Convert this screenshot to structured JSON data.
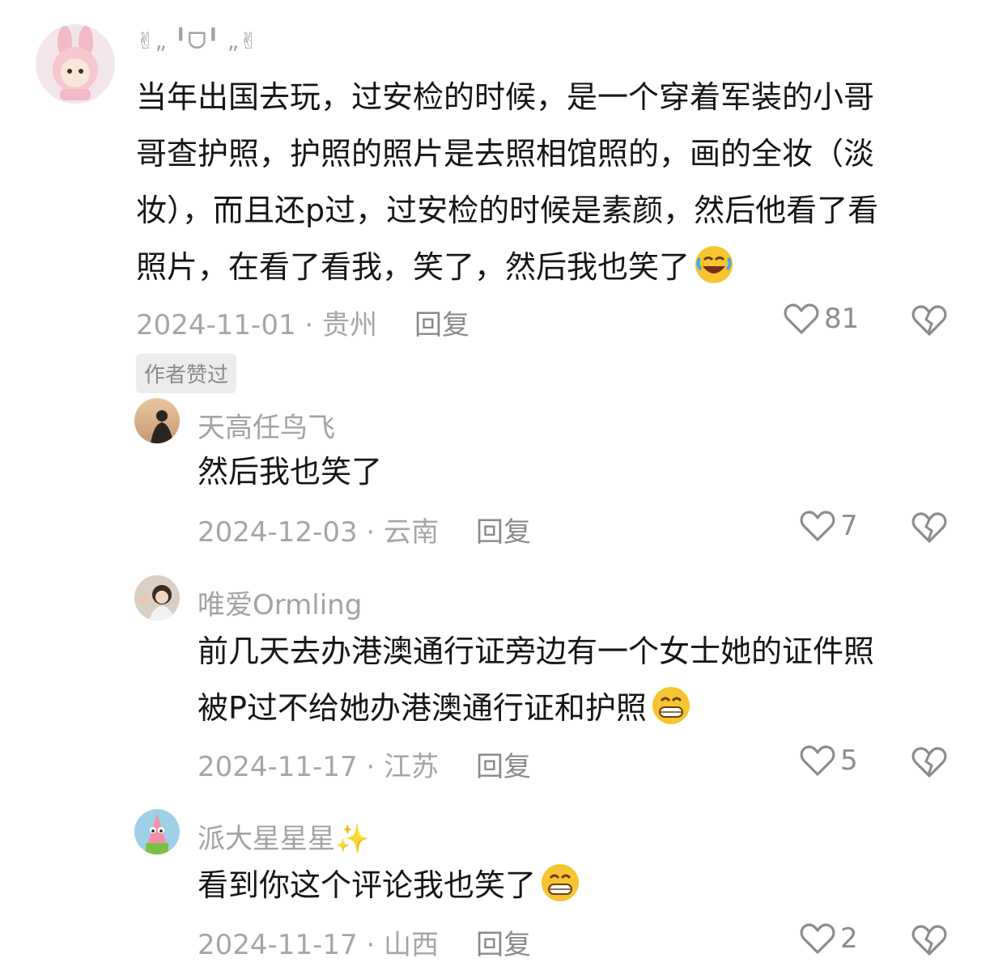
{
  "comments": [
    {
      "user": "✌︎„ ╹ᗜ╹ „✌︎",
      "lines": [
        "当年出国去玩，过安检的时候，是一个穿着军装的小哥",
        "哥查护照，护照的照片是去照相馆照的，画的全妆（淡",
        "妆），而且还p过，过安检的时候是素颜，然后他看了看",
        "照片，在看了看我，笑了，然后我也笑了"
      ],
      "emoji": "rofl-emoji",
      "date": "2024-11-01",
      "location": "贵州",
      "reply": "回复",
      "likes": "81",
      "badge": "作者赞过"
    },
    {
      "user": "天高任鸟飞",
      "lines": [
        "然后我也笑了"
      ],
      "date": "2024-12-03",
      "location": "云南",
      "reply": "回复",
      "likes": "7"
    },
    {
      "user": "唯爱Ormling",
      "lines": [
        "前几天去办港澳通行证旁边有一个女士她的证件照",
        "被P过不给她办港澳通行证和护照"
      ],
      "emoji": "grin-emoji",
      "date": "2024-11-17",
      "location": "江苏",
      "reply": "回复",
      "likes": "5"
    },
    {
      "user": "派大星星星✨",
      "lines": [
        "看到你这个评论我也笑了"
      ],
      "emoji": "grin-emoji",
      "date": "2024-11-17",
      "location": "山西",
      "reply": "回复",
      "likes": "2"
    }
  ],
  "separator": " · "
}
